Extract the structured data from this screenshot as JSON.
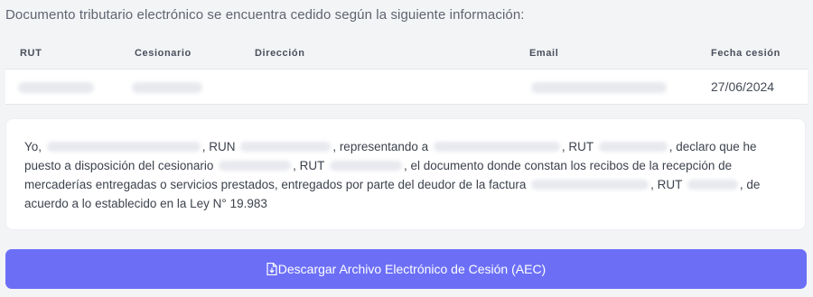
{
  "intro_text": "Documento tributario electrónico se encuentra cedido según la siguiente información:",
  "table": {
    "headers": [
      "RUT",
      "Cesionario",
      "Dirección",
      "Email",
      "Fecha cesión"
    ],
    "row": {
      "rut": "",
      "cesionario": "",
      "direccion": "",
      "email": "",
      "fecha_cesion": "27/06/2024"
    }
  },
  "declaration": {
    "yo": "Yo,",
    "run": ", RUN",
    "representando": ", representando a",
    "rut1": ", RUT",
    "declaro": ", declaro que he puesto a",
    "disposicion": "disposición del cesionario",
    "rut2": ", RUT",
    "documento": ", el documento donde constan los recibos de la recepción de mercaderías",
    "entregadas": "entregadas o servicios prestados, entregados por parte del deudor de la factura",
    "rut3": ", RUT",
    "acuerdo": ", de acuerdo a lo",
    "ley": "establecido en la Ley N° 19.983"
  },
  "download_button": {
    "label": "Descargar Archivo Electrónico de Cesión (AEC)",
    "icon": "file-download-icon"
  },
  "colors": {
    "accent": "#6c6ff6",
    "background": "#f3f4f6",
    "card": "#ffffff"
  }
}
